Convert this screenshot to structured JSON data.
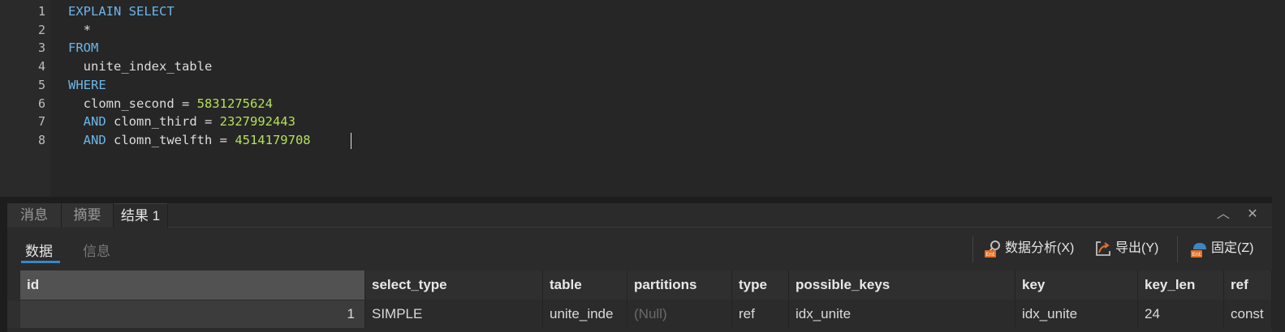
{
  "editor": {
    "line_numbers": [
      "1",
      "2",
      "3",
      "4",
      "5",
      "6",
      "7",
      "8"
    ],
    "lines": [
      [
        {
          "t": "EXPLAIN SELECT",
          "c": "kw"
        }
      ],
      [
        {
          "t": "  *",
          "c": ""
        }
      ],
      [
        {
          "t": "FROM",
          "c": "kw"
        }
      ],
      [
        {
          "t": "  unite_index_table",
          "c": ""
        }
      ],
      [
        {
          "t": "WHERE",
          "c": "kw"
        }
      ],
      [
        {
          "t": "  clomn_second = ",
          "c": ""
        },
        {
          "t": "5831275624",
          "c": "num"
        }
      ],
      [
        {
          "t": "  ",
          "c": ""
        },
        {
          "t": "AND",
          "c": "kw"
        },
        {
          "t": " clomn_third = ",
          "c": ""
        },
        {
          "t": "2327992443",
          "c": "num"
        }
      ],
      [
        {
          "t": "  ",
          "c": ""
        },
        {
          "t": "AND",
          "c": "kw"
        },
        {
          "t": " clomn_twelfth = ",
          "c": ""
        },
        {
          "t": "4514179708",
          "c": "num"
        }
      ]
    ]
  },
  "tabs": {
    "messages": "消息",
    "summary": "摘要",
    "result": "结果 1"
  },
  "window_controls": {
    "collapse": "︿",
    "close": "✕"
  },
  "subtabs": {
    "data": "数据",
    "info": "信息"
  },
  "toolbar": {
    "analyze": "数据分析(X)",
    "export": "导出(Y)",
    "pin": "固定(Z)"
  },
  "grid": {
    "columns": [
      "id",
      "select_type",
      "table",
      "partitions",
      "type",
      "possible_keys",
      "key",
      "key_len",
      "ref"
    ],
    "rows": [
      [
        "1",
        "SIMPLE",
        "unite_inde",
        "(Null)",
        "ref",
        "idx_unite",
        "idx_unite",
        "24",
        "const"
      ]
    ]
  },
  "colors": {
    "keyword": "#6cb6ea",
    "number": "#b4e05a",
    "accent": "#3b86c6",
    "icon_badge": "#e0702a"
  }
}
